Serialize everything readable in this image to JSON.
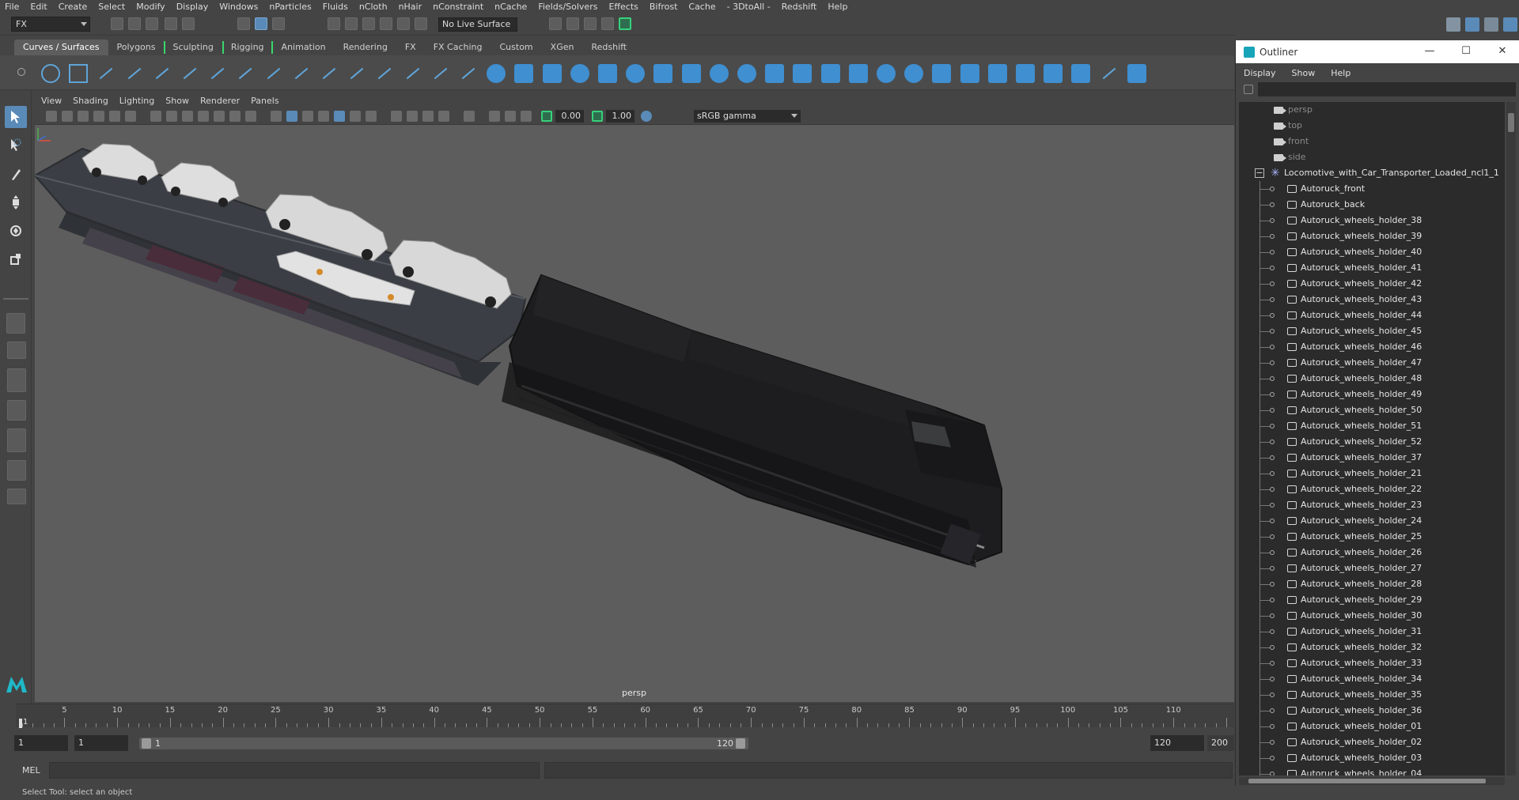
{
  "menubar": [
    "File",
    "Edit",
    "Create",
    "Select",
    "Modify",
    "Display",
    "Windows",
    "nParticles",
    "Fluids",
    "nCloth",
    "nHair",
    "nConstraint",
    "nCache",
    "Fields/Solvers",
    "Effects",
    "Bifrost",
    "Cache",
    "- 3DtoAll -",
    "Redshift",
    "Help"
  ],
  "statusline": {
    "menuset": "FX",
    "live_surface": "No Live Surface"
  },
  "shelf": {
    "tabs": [
      "Curves / Surfaces",
      "Polygons",
      "Sculpting",
      "Rigging",
      "Animation",
      "Rendering",
      "FX",
      "FX Caching",
      "Custom",
      "XGen",
      "Redshift"
    ],
    "active_tab": "Curves / Surfaces"
  },
  "viewport": {
    "menu": [
      "View",
      "Shading",
      "Lighting",
      "Show",
      "Renderer",
      "Panels"
    ],
    "exposure": "0.00",
    "gamma": "1.00",
    "colorspace": "sRGB gamma",
    "camera_label": "persp"
  },
  "timeslider": {
    "ticks": [
      "5",
      "10",
      "15",
      "20",
      "25",
      "30",
      "35",
      "40",
      "45",
      "50",
      "55",
      "60",
      "65",
      "70",
      "75",
      "80",
      "85",
      "90",
      "95",
      "100",
      "105",
      "110"
    ],
    "current_frame": "1"
  },
  "rangeslider": {
    "start": "1",
    "playback_start": "1",
    "range_start_label": "1",
    "range_end_label": "120",
    "playback_end": "120",
    "end": "200"
  },
  "cmdline": {
    "label": "MEL"
  },
  "helpline": "Select Tool: select an object",
  "outliner": {
    "title": "Outliner",
    "menu": [
      "Display",
      "Show",
      "Help"
    ],
    "cameras": [
      "persp",
      "top",
      "front",
      "side"
    ],
    "group": "Locomotive_with_Car_Transporter_Loaded_ncl1_1",
    "items": [
      "Autoruck_front",
      "Autoruck_back",
      "Autoruck_wheels_holder_38",
      "Autoruck_wheels_holder_39",
      "Autoruck_wheels_holder_40",
      "Autoruck_wheels_holder_41",
      "Autoruck_wheels_holder_42",
      "Autoruck_wheels_holder_43",
      "Autoruck_wheels_holder_44",
      "Autoruck_wheels_holder_45",
      "Autoruck_wheels_holder_46",
      "Autoruck_wheels_holder_47",
      "Autoruck_wheels_holder_48",
      "Autoruck_wheels_holder_49",
      "Autoruck_wheels_holder_50",
      "Autoruck_wheels_holder_51",
      "Autoruck_wheels_holder_52",
      "Autoruck_wheels_holder_37",
      "Autoruck_wheels_holder_21",
      "Autoruck_wheels_holder_22",
      "Autoruck_wheels_holder_23",
      "Autoruck_wheels_holder_24",
      "Autoruck_wheels_holder_25",
      "Autoruck_wheels_holder_26",
      "Autoruck_wheels_holder_27",
      "Autoruck_wheels_holder_28",
      "Autoruck_wheels_holder_29",
      "Autoruck_wheels_holder_30",
      "Autoruck_wheels_holder_31",
      "Autoruck_wheels_holder_32",
      "Autoruck_wheels_holder_33",
      "Autoruck_wheels_holder_34",
      "Autoruck_wheels_holder_35",
      "Autoruck_wheels_holder_36",
      "Autoruck_wheels_holder_01",
      "Autoruck_wheels_holder_02",
      "Autoruck_wheels_holder_03",
      "Autoruck_wheels_holder_04"
    ]
  }
}
